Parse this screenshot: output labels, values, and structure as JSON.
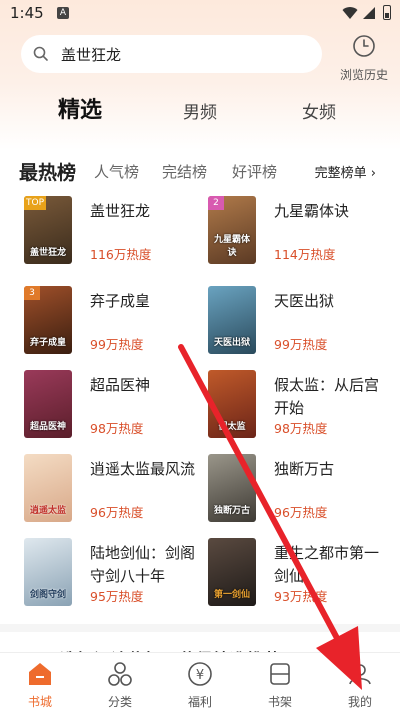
{
  "status_bar": {
    "time": "1:45",
    "notice_icon": "A"
  },
  "search": {
    "query": "盖世狂龙"
  },
  "history": {
    "label": "浏览历史"
  },
  "tabs": [
    {
      "label": "精选",
      "active": true
    },
    {
      "label": "男频",
      "active": false
    },
    {
      "label": "女频",
      "active": false
    }
  ],
  "rank_tabs": {
    "items": [
      "最热榜",
      "人气榜",
      "完结榜",
      "好评榜"
    ],
    "all_label": "完整榜单 ›"
  },
  "books": [
    {
      "title": "盖世狂龙",
      "heat": "116万热度",
      "badge": "TOP",
      "cover_text": "盖世狂龙",
      "color": "#3a2b1c"
    },
    {
      "title": "九星霸体诀",
      "heat": "114万热度",
      "badge": "2",
      "cover_text": "九星霸体诀",
      "color": "#5b3a24"
    },
    {
      "title": "弃子成皇",
      "heat": "99万热度",
      "badge": "3",
      "cover_text": "弃子成皇",
      "color": "#3a1e10"
    },
    {
      "title": "天医出狱",
      "heat": "99万热度",
      "badge": "",
      "cover_text": "天医出狱",
      "color": "#2a4a5c"
    },
    {
      "title": "超品医神",
      "heat": "98万热度",
      "badge": "",
      "cover_text": "超品医神",
      "color": "#5a1e2a"
    },
    {
      "title": "假太监：从后宫开始",
      "heat": "98万热度",
      "badge": "",
      "cover_text": "假太监",
      "color": "#6b2418"
    },
    {
      "title": "逍遥太监最风流",
      "heat": "96万热度",
      "badge": "",
      "cover_text": "逍遥太监",
      "color": "#e9c9a8"
    },
    {
      "title": "独断万古",
      "heat": "96万热度",
      "badge": "",
      "cover_text": "独断万古",
      "color": "#5e5a52"
    },
    {
      "title": "陆地剑仙：剑阁守剑八十年",
      "heat": "95万热度",
      "badge": "",
      "cover_text": "剑阁守剑",
      "color": "#aebfcc"
    },
    {
      "title": "重生之都市第一剑仙",
      "heat": "93万热度",
      "badge": "",
      "cover_text": "第一剑仙",
      "color": "#2d2a28"
    }
  ],
  "promo": {
    "text": "选择阅读偏好，获得精准推荐"
  },
  "nav": [
    {
      "label": "书城",
      "icon": "home-icon",
      "active": true
    },
    {
      "label": "分类",
      "icon": "category-icon",
      "active": false
    },
    {
      "label": "福利",
      "icon": "yen-icon",
      "active": false
    },
    {
      "label": "书架",
      "icon": "bookshelf-icon",
      "active": false
    },
    {
      "label": "我的",
      "icon": "user-icon",
      "active": false
    }
  ],
  "colors": {
    "accent": "#ee6b2d",
    "heat": "#d94f2a",
    "arrow": "#e8232a"
  }
}
